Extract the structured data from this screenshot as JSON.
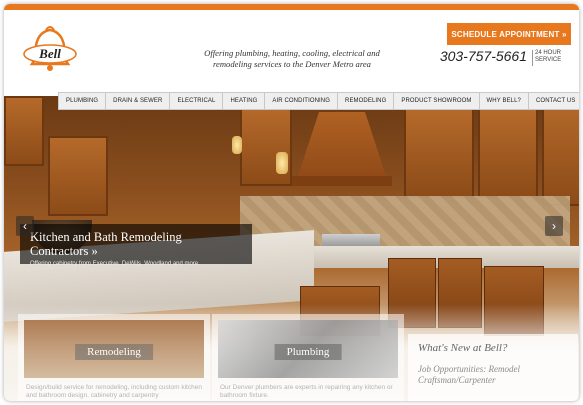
{
  "header": {
    "logo_text": "Bell",
    "tagline": "Offering plumbing, heating, cooling, electrical and remodeling services to the Denver Metro area",
    "schedule_button": "SCHEDULE APPOINTMENT »",
    "phone": "303-757-5661",
    "hours_line1": "24 HOUR",
    "hours_line2": "SERVICE"
  },
  "nav": {
    "items": [
      {
        "label": "PLUMBING"
      },
      {
        "label": "DRAIN & SEWER"
      },
      {
        "label": "ELECTRICAL"
      },
      {
        "label": "HEATING"
      },
      {
        "label": "AIR CONDITIONING"
      },
      {
        "label": "REMODELING"
      },
      {
        "label": "PRODUCT SHOWROOM"
      },
      {
        "label": "WHY BELL?"
      },
      {
        "label": "CONTACT US"
      }
    ]
  },
  "hero": {
    "title": "Kitchen and Bath Remodeling Contractors »",
    "subtitle": "Offering cabinetry from Executive, DeWils, Woodland and more.",
    "prev_arrow": "‹",
    "next_arrow": "›"
  },
  "cards": {
    "remodeling": {
      "label": "Remodeling",
      "text": "Design/build service for remodeling, including custom kitchen and bathroom design, cabinetry and carpentry"
    },
    "plumbing": {
      "label": "Plumbing",
      "text": "Our Denver plumbers are experts in repairing any kitchen or bathroom fixture."
    }
  },
  "news": {
    "title": "What's New at Bell?",
    "item": "Job Opportunities: Remodel Craftsman/Carpenter"
  },
  "colors": {
    "accent": "#e8781e",
    "wood": "#9a5420",
    "granite": "#e6e0d6"
  }
}
